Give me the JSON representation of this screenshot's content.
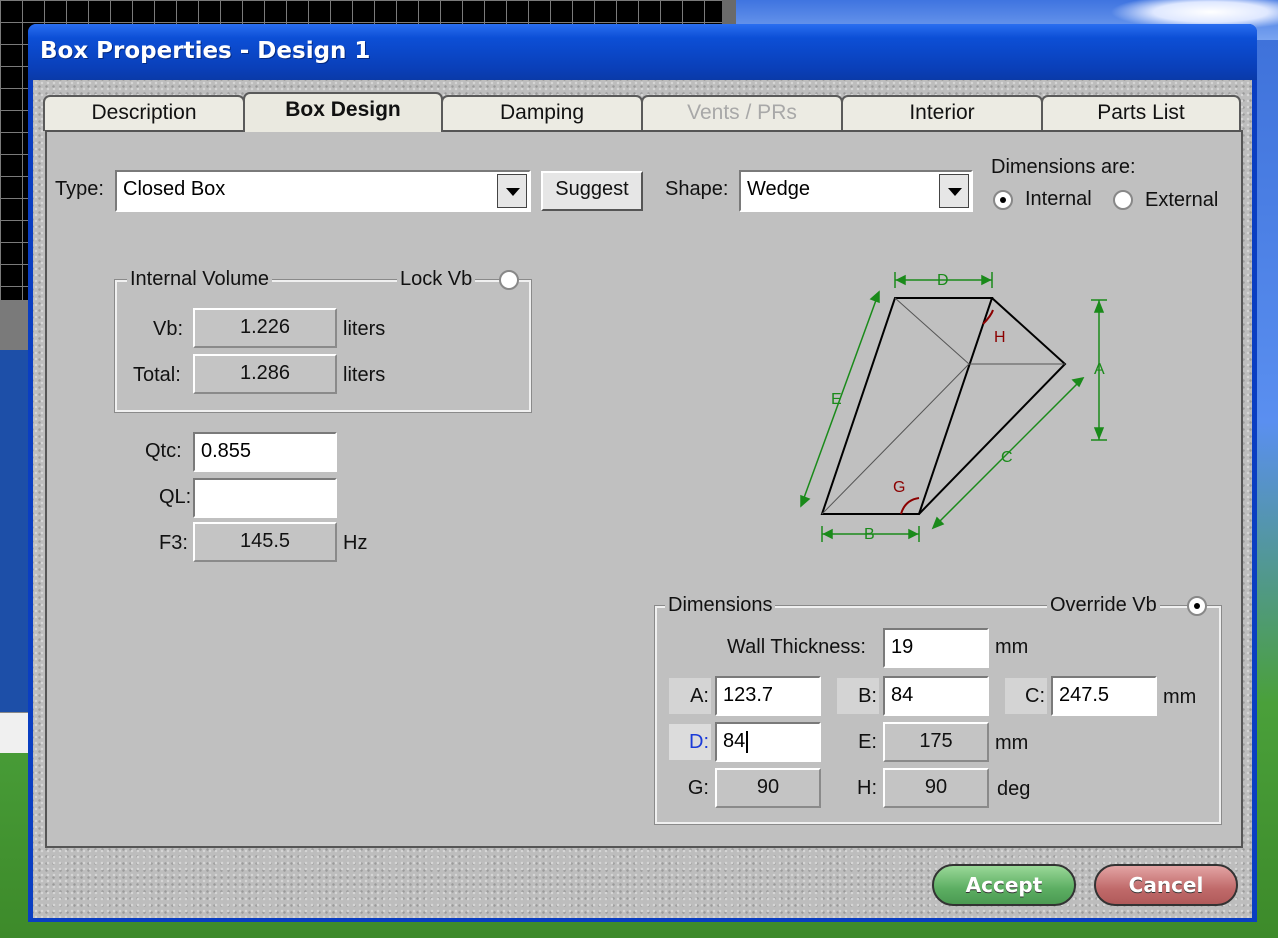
{
  "window": {
    "title": "Box Properties - Design 1"
  },
  "tabs": [
    {
      "label": "Description"
    },
    {
      "label": "Box Design"
    },
    {
      "label": "Damping"
    },
    {
      "label": "Vents / PRs"
    },
    {
      "label": "Interior"
    },
    {
      "label": "Parts List"
    }
  ],
  "box_design": {
    "type_label": "Type:",
    "type_value": "Closed Box",
    "suggest_label": "Suggest",
    "shape_label": "Shape:",
    "shape_value": "Wedge",
    "dimensions_are_label": "Dimensions are:",
    "internal_label": "Internal",
    "external_label": "External",
    "dimensions_are_selected": "Internal",
    "internal_volume": {
      "title": "Internal Volume",
      "lock_label": "Lock Vb",
      "vb_label": "Vb:",
      "vb_value": "1.226",
      "vb_unit": "liters",
      "total_label": "Total:",
      "total_value": "1.286",
      "total_unit": "liters"
    },
    "qtc_label": "Qtc:",
    "qtc_value": "0.855",
    "ql_label": "QL:",
    "ql_value": "",
    "f3_label": "F3:",
    "f3_value": "145.5",
    "f3_unit": "Hz",
    "diagram": {
      "d": "D",
      "h": "H",
      "a": "A",
      "e": "E",
      "c": "C",
      "g": "G",
      "b": "B",
      "line_color": "#000000",
      "dim_color": "#1a8a1a",
      "angle_color": "#8b0000"
    },
    "dimensions": {
      "title": "Dimensions",
      "override_label": "Override Vb",
      "wall_label": "Wall Thickness:",
      "wall_value": "19",
      "wall_unit": "mm",
      "a_label": "A:",
      "a_value": "123.7",
      "b_label": "B:",
      "b_value": "84",
      "c_label": "C:",
      "c_value": "247.5",
      "row1_unit": "mm",
      "d_label": "D:",
      "d_value": "84",
      "e_label": "E:",
      "e_value": "175",
      "row2_unit": "mm",
      "g_label": "G:",
      "g_value": "90",
      "h_label": "H:",
      "h_value": "90",
      "row3_unit": "deg"
    }
  },
  "footer": {
    "accept_label": "Accept",
    "cancel_label": "Cancel"
  },
  "colors": {
    "title_bar": "#0a3fb8",
    "accept": "#5cae62",
    "cancel": "#c06a6a",
    "focused_label": "#1b3bd8"
  }
}
